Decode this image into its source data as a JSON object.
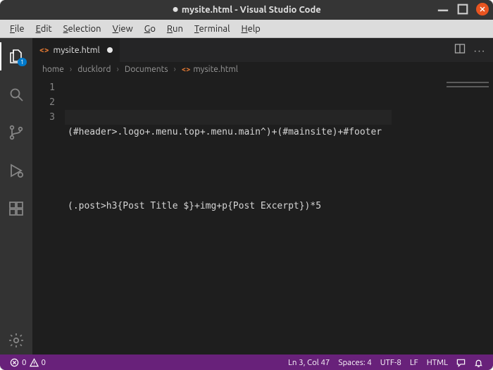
{
  "window": {
    "title_prefix_dirty": "●",
    "title": "mysite.html - Visual Studio Code"
  },
  "menu": {
    "items": [
      {
        "label": "File",
        "u": "F"
      },
      {
        "label": "Edit",
        "u": "E"
      },
      {
        "label": "Selection",
        "u": "S"
      },
      {
        "label": "View",
        "u": "V"
      },
      {
        "label": "Go",
        "u": "G"
      },
      {
        "label": "Run",
        "u": "R"
      },
      {
        "label": "Terminal",
        "u": "T"
      },
      {
        "label": "Help",
        "u": "H"
      }
    ]
  },
  "activity": {
    "explorer_badge": "1"
  },
  "tab": {
    "filename": "mysite.html"
  },
  "breadcrumbs": {
    "seg1": "home",
    "seg2": "ducklord",
    "seg3": "Documents",
    "seg4": "mysite.html"
  },
  "editor": {
    "lines": [
      "(#header>.logo+.menu.top+.menu.main^)+(#mainsite)+#footer",
      "",
      "(.post>h3{Post Title $}+img+p{Post Excerpt})*5"
    ],
    "line_numbers": [
      "1",
      "2",
      "3"
    ]
  },
  "status": {
    "errors": "0",
    "warnings": "0",
    "cursor": "Ln 3, Col 47",
    "spaces": "Spaces: 4",
    "encoding": "UTF-8",
    "eol": "LF",
    "language": "HTML"
  }
}
